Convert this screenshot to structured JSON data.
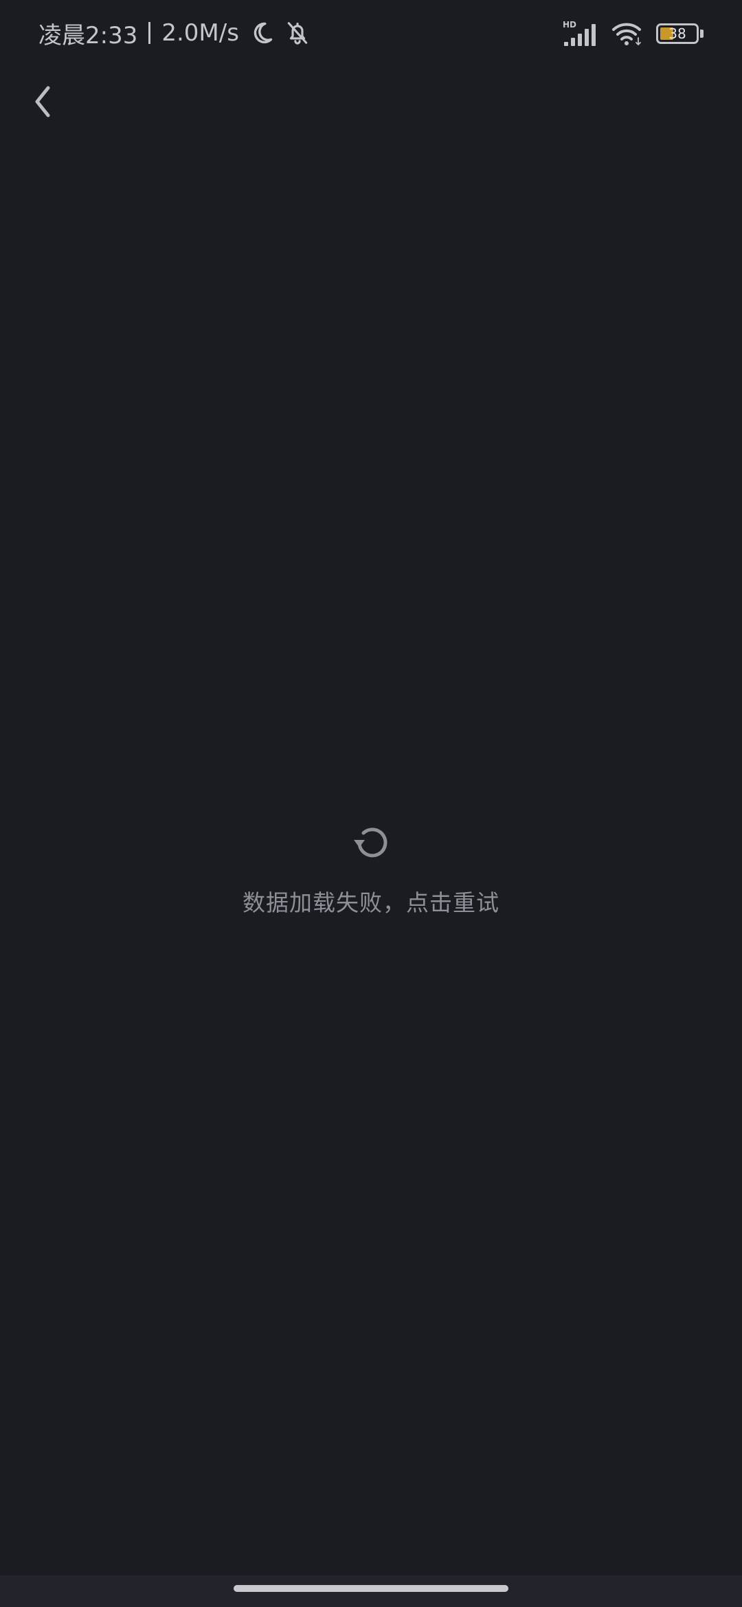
{
  "status_bar": {
    "time": "凌晨2:33",
    "network_speed": "2.0M/s",
    "signal_label": "HD",
    "battery_level": "38",
    "battery_percent": 0.38,
    "battery_color": "#c9972a",
    "icons": [
      "moon-icon",
      "bell-off-icon",
      "signal-icon",
      "wifi-icon",
      "battery-icon"
    ]
  },
  "header": {
    "back_icon": "chevron-left-icon"
  },
  "error_state": {
    "icon": "refresh-icon",
    "message": "数据加载失败，点击重试"
  },
  "colors": {
    "background": "#1b1b22",
    "text_muted": "#8f8f97",
    "status_text": "#c4c4cb"
  }
}
